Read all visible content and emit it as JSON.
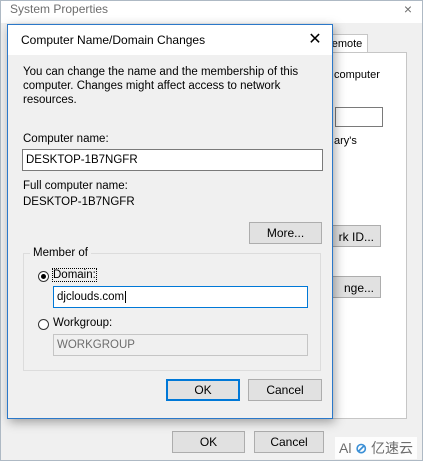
{
  "background_window": {
    "title": "System Properties",
    "close_glyph": "×",
    "tab_label": "emote",
    "text_computer": "computer",
    "text_ary": "ary's",
    "network_id_label": "rk ID...",
    "change_label": "nge...",
    "ok_label": "OK",
    "cancel_label": "Cancel"
  },
  "dialog": {
    "title": "Computer Name/Domain Changes",
    "close_glyph": "✕",
    "intro": "You can change the name and the membership of this computer. Changes might affect access to network resources.",
    "computer_name_label": "Computer name:",
    "computer_name_value": "DESKTOP-1B7NGFR",
    "full_name_label": "Full computer name:",
    "full_name_value": "DESKTOP-1B7NGFR",
    "more_label": "More...",
    "member_of_label": "Member of",
    "domain_label": "Domain:",
    "domain_value": "djclouds.com",
    "workgroup_label": "Workgroup:",
    "workgroup_value": "WORKGROUP",
    "ok_label": "OK",
    "cancel_label": "Cancel",
    "selected_membership": "domain"
  },
  "watermark": {
    "left_text": "Al",
    "brand_text": "亿速云"
  },
  "colors": {
    "accent": "#0078d7",
    "dialog_border": "#2b78c9",
    "window_bg": "#f0f0f0"
  }
}
